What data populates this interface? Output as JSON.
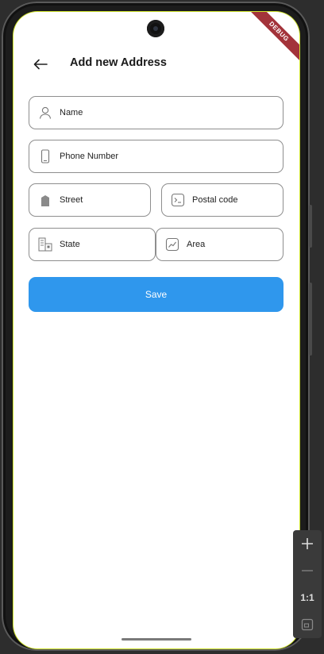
{
  "app_bar": {
    "back_icon": "arrow-left-icon",
    "title": "Add new Address"
  },
  "debug_banner": "DEBUG",
  "form": {
    "name": {
      "label": "Name",
      "icon": "person-icon"
    },
    "phone": {
      "label": "Phone Number",
      "icon": "phone-icon"
    },
    "street": {
      "label": "Street",
      "icon": "building-icon"
    },
    "postal": {
      "label": "Postal code",
      "icon": "terminal-icon"
    },
    "state": {
      "label": "State",
      "icon": "city-icon"
    },
    "area": {
      "label": "Area",
      "icon": "chart-icon"
    }
  },
  "save_label": "Save",
  "emulator_toolbar": {
    "zoom_in": "+",
    "zoom_out": "—",
    "actual_size": "1:1",
    "fit": "fit-screen-icon"
  },
  "colors": {
    "primary": "#2f97ed",
    "debug": "#a3333a",
    "border": "#8e8e8e"
  }
}
